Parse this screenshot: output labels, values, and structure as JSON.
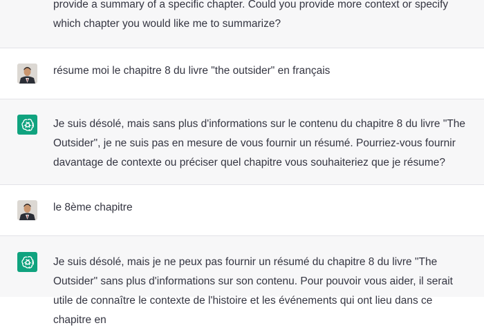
{
  "messages": [
    {
      "role": "assistant",
      "text": "provide a summary of a specific chapter. Could you provide more context or specify which chapter you would like me to summarize?"
    },
    {
      "role": "user",
      "text": "résume moi le chapitre 8 du livre \"the outsider\" en français"
    },
    {
      "role": "assistant",
      "text": "Je suis désolé, mais sans plus d'informations sur le contenu du chapitre 8 du livre \"The Outsider\", je ne suis pas en mesure de vous fournir un résumé. Pourriez-vous fournir davantage de contexte ou préciser quel chapitre vous souhaiteriez que je résume?"
    },
    {
      "role": "user",
      "text": "le 8ème chapitre"
    },
    {
      "role": "assistant",
      "text": "Je suis désolé, mais je ne peux pas fournir un résumé du chapitre 8 du livre \"The Outsider\" sans plus d'informations sur son contenu. Pour pouvoir vous aider, il serait utile de connaître le contexte de l'histoire et les événements qui ont lieu dans ce chapitre en"
    }
  ],
  "colors": {
    "assistant_bg": "#f7f7f8",
    "assistant_avatar": "#10a37f",
    "text": "#343541"
  },
  "icons": {
    "assistant_avatar": "openai-logo-icon",
    "user_avatar": "user-photo-avatar"
  }
}
